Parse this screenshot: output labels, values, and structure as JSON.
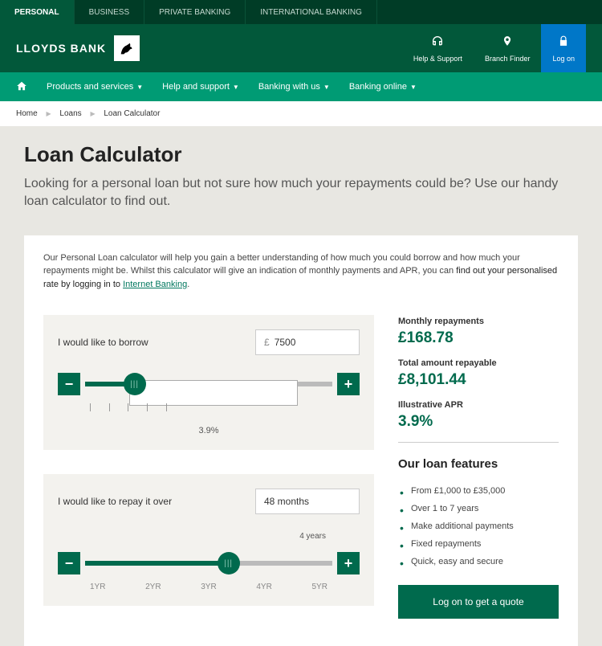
{
  "topnav": {
    "items": [
      "PERSONAL",
      "BUSINESS",
      "PRIVATE BANKING",
      "INTERNATIONAL BANKING"
    ]
  },
  "brand": "LLOYDS BANK",
  "header": {
    "help": "Help & Support",
    "branch": "Branch Finder",
    "logon": "Log on"
  },
  "mainnav": {
    "items": [
      "Products and services",
      "Help and support",
      "Banking with us",
      "Banking online"
    ]
  },
  "breadcrumb": {
    "home": "Home",
    "loans": "Loans",
    "calc": "Loan Calculator"
  },
  "hero": {
    "title": "Loan Calculator",
    "sub": "Looking for a personal loan but not sure how much your repayments could be? Use our handy loan calculator to find out."
  },
  "intro": {
    "text": "Our Personal Loan calculator will help you gain a better understanding of how much you could borrow and how much your repayments might be. Whilst this calculator will give an indication of monthly payments and APR, you can ",
    "bold": "find out your personalised rate by logging in to ",
    "link": "Internet Banking"
  },
  "borrow": {
    "label": "I would like to borrow",
    "value": "7500",
    "apr": "3.9%"
  },
  "repay": {
    "label": "I would like to repay it over",
    "value": "48 months",
    "sub": "4 years",
    "ticks": [
      "1YR",
      "2YR",
      "3YR",
      "4YR",
      "5YR"
    ]
  },
  "results": {
    "monthly_label": "Monthly repayments",
    "monthly": "£168.78",
    "total_label": "Total amount repayable",
    "total": "£8,101.44",
    "apr_label": "Illustrative APR",
    "apr": "3.9%"
  },
  "features": {
    "title": "Our loan features",
    "items": [
      "From £1,000 to £35,000",
      "Over 1 to 7 years",
      "Make additional payments",
      "Fixed repayments",
      "Quick, easy and secure"
    ]
  },
  "cta": "Log on to get a quote"
}
